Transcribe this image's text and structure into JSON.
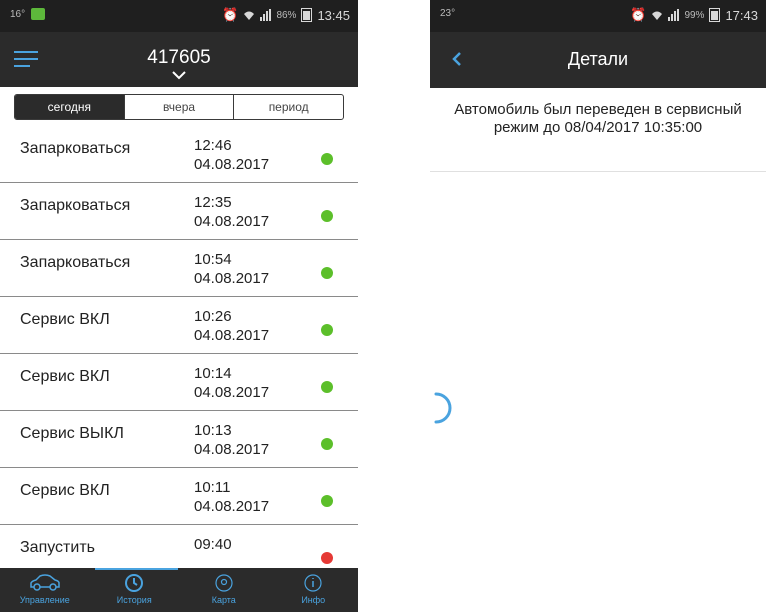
{
  "left": {
    "status": {
      "left_text": "16°",
      "alarm": "⏰",
      "battery_pct": "86%",
      "time": "13:45"
    },
    "toolbar": {
      "title": "417605"
    },
    "segments": [
      {
        "label": "сегодня",
        "active": true
      },
      {
        "label": "вчера",
        "active": false
      },
      {
        "label": "период",
        "active": false
      }
    ],
    "events": [
      {
        "name": "Запарковаться",
        "time": "12:46",
        "date": "04.08.2017",
        "status": "green"
      },
      {
        "name": "Запарковаться",
        "time": "12:35",
        "date": "04.08.2017",
        "status": "green"
      },
      {
        "name": "Запарковаться",
        "time": "10:54",
        "date": "04.08.2017",
        "status": "green"
      },
      {
        "name": "Сервис ВКЛ",
        "time": "10:26",
        "date": "04.08.2017",
        "status": "green"
      },
      {
        "name": "Сервис ВКЛ",
        "time": "10:14",
        "date": "04.08.2017",
        "status": "green"
      },
      {
        "name": "Сервис ВЫКЛ",
        "time": "10:13",
        "date": "04.08.2017",
        "status": "green"
      },
      {
        "name": "Сервис ВКЛ",
        "time": "10:11",
        "date": "04.08.2017",
        "status": "green"
      },
      {
        "name": "Запустить",
        "time": "09:40",
        "date": "",
        "status": "red"
      }
    ],
    "tabs": [
      {
        "label": "Управление",
        "icon": "car-icon"
      },
      {
        "label": "История",
        "icon": "history-icon"
      },
      {
        "label": "Карта",
        "icon": "map-pin-icon"
      },
      {
        "label": "Инфо",
        "icon": "info-icon"
      }
    ]
  },
  "right": {
    "status": {
      "left_text": "23°",
      "alarm": "⏰",
      "battery_pct": "99%",
      "time": "17:43"
    },
    "toolbar": {
      "title": "Детали"
    },
    "detail_text": "Автомобиль был переведен в сервисный режим до 08/04/2017 10:35:00"
  },
  "colors": {
    "accent": "#4aa3df",
    "bar": "#2b2b2b",
    "green": "#5cbf2a",
    "red": "#e53935"
  }
}
